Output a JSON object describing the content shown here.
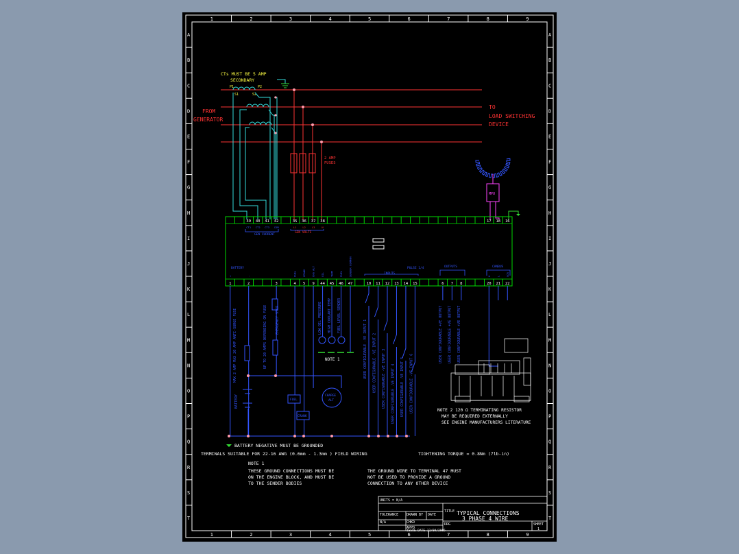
{
  "viewer": {
    "background": "#8a9aae",
    "sheet_background": "#000000"
  },
  "colors": {
    "frame": "#ffffff",
    "controller": "#00dd00",
    "phase": "#ff3333",
    "ct_wire": "#33dddd",
    "lower_wire": "#3355ff",
    "ground": "#33dd33",
    "connector": "#ff99aa",
    "mpu": "#ff44ff",
    "engine": "#ffffff"
  },
  "border": {
    "columns": [
      "1",
      "2",
      "3",
      "4",
      "5",
      "6",
      "7",
      "8",
      "9"
    ],
    "rows": [
      "A",
      "B",
      "C",
      "D",
      "E",
      "F",
      "G",
      "H",
      "I",
      "J",
      "K",
      "L",
      "M",
      "N",
      "O",
      "P",
      "Q",
      "R",
      "S",
      "T"
    ]
  },
  "top_labels": {
    "ct_note": "CTs MUST BE 5 AMP",
    "ct_note2": "SECONDARY",
    "p1": "P1",
    "p2": "P2",
    "s1": "S1",
    "s2": "S2",
    "from_gen_1": "FROM",
    "from_gen_2": "GENERATOR",
    "to_load_1": "TO",
    "to_load_2": "LOAD SWITCHING",
    "to_load_3": "DEVICE",
    "fuses_1": "2 AMP",
    "fuses_2": "FUSES",
    "mpu": "MPU"
  },
  "terminals_top": [
    {
      "num": "39",
      "sub": "CT1"
    },
    {
      "num": "40",
      "sub": "CT2"
    },
    {
      "num": "41",
      "sub": "CT3"
    },
    {
      "num": "42",
      "sub": "COM"
    },
    {
      "num": "35",
      "sub": "L1"
    },
    {
      "num": "36",
      "sub": "L2"
    },
    {
      "num": "37",
      "sub": "L3"
    },
    {
      "num": "38",
      "sub": "N"
    },
    {
      "num": "17",
      "sub": ""
    },
    {
      "num": "18",
      "sub": ""
    },
    {
      "num": "16",
      "sub": ""
    }
  ],
  "group_labels": {
    "gen_current": "GEN CURRENT",
    "gen_volts": "GEN VOLTS",
    "battery": "BATTERY",
    "inputs": "INPUTS",
    "outputs": "OUTPUTS",
    "pulse": "PULSE 1/4",
    "canbus": "CANBUS"
  },
  "terminals_bottom": [
    {
      "num": "1",
      "sub": "+"
    },
    {
      "num": "2",
      "sub": "-"
    },
    {
      "num": "3",
      "sub": ""
    },
    {
      "num": "4",
      "sub": "FUEL"
    },
    {
      "num": "5",
      "sub": "CRANK"
    },
    {
      "num": "9",
      "sub": "CHG ALT"
    },
    {
      "num": "44",
      "sub": "OIL"
    },
    {
      "num": "45",
      "sub": "TEMP"
    },
    {
      "num": "46",
      "sub": "FUEL"
    },
    {
      "num": "47",
      "sub": "SENDER COMMON"
    },
    {
      "num": "10",
      "sub": ""
    },
    {
      "num": "11",
      "sub": ""
    },
    {
      "num": "12",
      "sub": ""
    },
    {
      "num": "13",
      "sub": ""
    },
    {
      "num": "14",
      "sub": ""
    },
    {
      "num": "15",
      "sub": ""
    },
    {
      "num": "6",
      "sub": ""
    },
    {
      "num": "7",
      "sub": ""
    },
    {
      "num": "8",
      "sub": ""
    },
    {
      "num": "20",
      "sub": "H"
    },
    {
      "num": "21",
      "sub": "L"
    },
    {
      "num": "22",
      "sub": "SCR"
    }
  ],
  "vertical_labels": {
    "fuse1": "MAX 2 AMP MAX 20 AMP ANTI-SURGE FUSE",
    "fuse2": "UP TO 20 AMPS DEPENDING ON FUSE",
    "estop": "EMERGENCY STOP",
    "oil": "LOW OIL PRESSURE",
    "temp": "HIGH COOLANT TEMP",
    "fuelsend": "FUEL LEVEL SENDER",
    "in1": "USER CONFIGURABLE -VE INPUT 1",
    "in2": "USER CONFIGURABLE -VE INPUT 2",
    "in3": "USER CONFIGURABLE -VE INPUT 3",
    "in4": "USER CONFIGURABLE -VE INPUT 4",
    "in5": "USER CONFIGURABLE -VE INPUT 5",
    "in6": "USER CONFIGURABLE -VE INPUT 6",
    "out1": "USER CONFIGURABLE +VE OUTPUT",
    "out2": "USER CONFIGURABLE +VE OUTPUT",
    "out3": "USER CONFIGURABLE +VE OUTPUT",
    "battery": "BATTERY"
  },
  "components": {
    "fuel": "FUEL",
    "crank": "CRANK",
    "charge_1": "CHARGE",
    "charge_2": "ALT"
  },
  "notes": {
    "note1_label": "NOTE 1",
    "note2": "NOTE 2  120 Ω TERMINATING RESISTOR",
    "note2_b": "MAY BE REQUIRED EXTERNALLY",
    "note2_c": "SEE ENGINE MANUFACTURERS LITERATURE",
    "battery_neg": "BATTERY NEGATIVE MUST BE GROUNDED",
    "terminals": "TERMINALS SUITABLE FOR 22-16 AWG (0.6mm - 1.3mm ) FIELD WIRING",
    "torque": "TIGHTENING TORQUE = 0.8Nm (7lb-in)",
    "note1_title": "NOTE 1",
    "note1_a": "THESE GROUND CONNECTIONS MUST BE",
    "note1_b": "ON THE ENGINE BLOCK, AND MUST BE",
    "note1_c": "TO THE SENDER BODIES",
    "ground_a": "THE GROUND WIRE TO TERMINAL 47 MUST",
    "ground_b": "NOT BE USED TO PROVIDE A GROUND",
    "ground_c": "CONNECTION TO ANY OTHER DEVICE"
  },
  "title_block": {
    "units": "UNITS = N/A",
    "tolerance": "TOLERANCE",
    "tolerance_val": "N/A",
    "drawn": "DRAWN BY",
    "date": "DATE",
    "checked": "CHKD",
    "approved": "APPD",
    "issue_date": "ISSUE DATE 12/09/2005",
    "title_label": "TITLE",
    "title_1": "TYPICAL CONNECTIONS",
    "title_2": "3 PHASE 4 WIRE",
    "drg_label": "DRG",
    "sheet_label": "SHEET",
    "sheet_val": "1"
  }
}
